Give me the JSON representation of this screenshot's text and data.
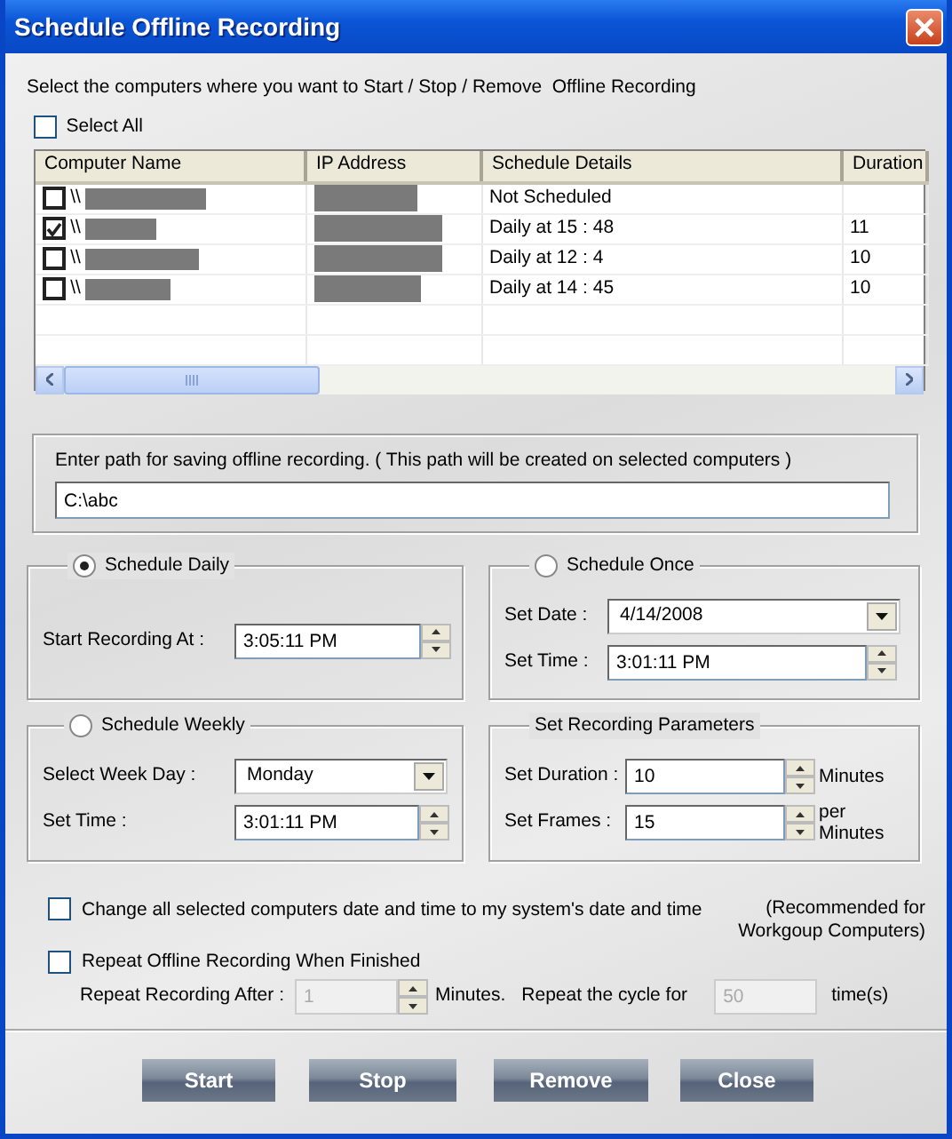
{
  "window": {
    "title": "Schedule Offline Recording"
  },
  "instruction": "Select the computers where you want to Start / Stop / Remove  Offline Recording",
  "select_all": {
    "label": "Select All",
    "checked": false
  },
  "table": {
    "columns": [
      "Computer Name",
      "IP Address",
      "Schedule Details",
      "Duration"
    ],
    "rows": [
      {
        "checked": false,
        "computer_name": "\\\\",
        "schedule_details": "Not Scheduled"
      },
      {
        "checked": true,
        "computer_name": "\\\\",
        "schedule_details": "Daily at  15 : 48",
        "duration": "11"
      },
      {
        "checked": false,
        "computer_name": "\\\\",
        "schedule_details": "Daily at  12 : 4",
        "duration": "10"
      },
      {
        "checked": false,
        "computer_name": "\\\\",
        "schedule_details": "Daily at  14 : 45",
        "duration": "10"
      }
    ]
  },
  "path": {
    "label": "Enter path for saving offline recording. ( This path will be created on selected computers )",
    "value": "C:\\abc"
  },
  "schedule_daily": {
    "label": "Schedule Daily",
    "selected": true,
    "start_label": "Start Recording At :",
    "start_value": "3:05:11 PM"
  },
  "schedule_once": {
    "label": "Schedule Once",
    "selected": false,
    "date_label": "Set Date :",
    "date_value": "4/14/2008",
    "time_label": "Set Time :",
    "time_value": "3:01:11 PM"
  },
  "schedule_weekly": {
    "label": "Schedule Weekly",
    "selected": false,
    "day_label": "Select Week Day :",
    "day_value": "Monday",
    "time_label": "Set Time :",
    "time_value": "3:01:11 PM"
  },
  "recording_parameters": {
    "title": "Set Recording Parameters",
    "duration_label": "Set Duration :",
    "duration_value": "10",
    "duration_unit": "Minutes",
    "frames_label": "Set Frames :",
    "frames_value": "15",
    "frames_unit": "per Minutes"
  },
  "sync_time": {
    "label": "Change all selected computers date and time to my system's date and time",
    "checked": false,
    "note": "(Recommended for Workgoup Computers)"
  },
  "repeat": {
    "label": "Repeat Offline Recording When Finished",
    "checked": false,
    "after_label": "Repeat Recording After :",
    "after_value": "1",
    "after_unit": "Minutes.",
    "cycle_label": "Repeat the cycle for",
    "cycle_value": "50",
    "cycle_unit": "time(s)"
  },
  "buttons": [
    "Start",
    "Stop",
    "Remove",
    "Close"
  ]
}
